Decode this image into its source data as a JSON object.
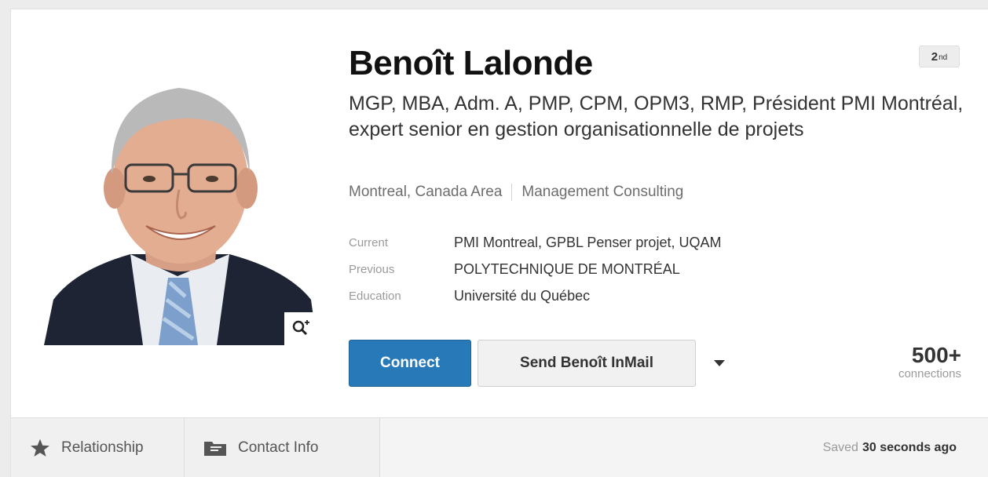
{
  "profile": {
    "name": "Benoît Lalonde",
    "degree": "2",
    "degree_suffix": "nd",
    "headline": "MGP, MBA, Adm. A, PMP, CPM, OPM3, RMP, Président PMI Montréal, expert senior en gestion organisationnelle de projets",
    "location": "Montreal, Canada Area",
    "industry": "Management Consulting"
  },
  "details": [
    {
      "label": "Current",
      "value": "PMI Montreal, GPBL Penser projet, UQAM"
    },
    {
      "label": "Previous",
      "value": "POLYTECHNIQUE DE MONTRÉAL"
    },
    {
      "label": "Education",
      "value": "Université du Québec"
    }
  ],
  "actions": {
    "connect_label": "Connect",
    "inmail_label": "Send Benoît InMail",
    "dropdown_icon": "caret-down-icon"
  },
  "connections": {
    "count": "500+",
    "label": "connections"
  },
  "footer": {
    "relationship_label": "Relationship",
    "contact_info_label": "Contact Info",
    "saved_prefix": "Saved",
    "saved_time": "30 seconds ago"
  },
  "icons": {
    "zoom": "zoom-in-icon",
    "relationship": "star-icon",
    "contact_info": "folder-icon"
  },
  "colors": {
    "connect_button": "#2879b8",
    "background": "#ffffff",
    "footer": "#f4f4f4"
  }
}
